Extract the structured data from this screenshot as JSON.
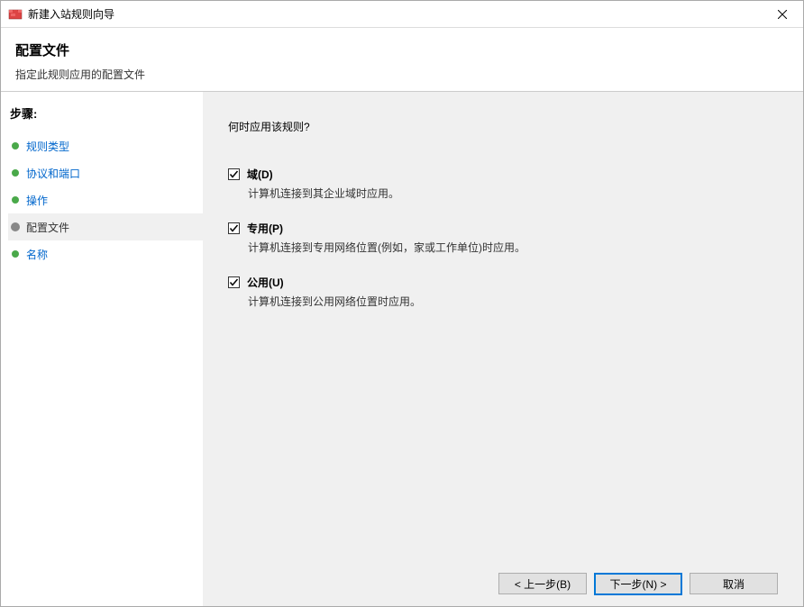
{
  "titlebar": {
    "title": "新建入站规则向导"
  },
  "header": {
    "title": "配置文件",
    "subtitle": "指定此规则应用的配置文件"
  },
  "sidebar": {
    "heading": "步骤:",
    "steps": [
      {
        "label": "规则类型",
        "active": false
      },
      {
        "label": "协议和端口",
        "active": false
      },
      {
        "label": "操作",
        "active": false
      },
      {
        "label": "配置文件",
        "active": true
      },
      {
        "label": "名称",
        "active": false
      }
    ]
  },
  "content": {
    "question": "何时应用该规则?",
    "options": [
      {
        "label": "域(D)",
        "desc": "计算机连接到其企业域时应用。",
        "checked": true
      },
      {
        "label": "专用(P)",
        "desc": "计算机连接到专用网络位置(例如，家或工作单位)时应用。",
        "checked": true
      },
      {
        "label": "公用(U)",
        "desc": "计算机连接到公用网络位置时应用。",
        "checked": true
      }
    ]
  },
  "buttons": {
    "back": "< 上一步(B)",
    "next": "下一步(N) >",
    "cancel": "取消"
  }
}
